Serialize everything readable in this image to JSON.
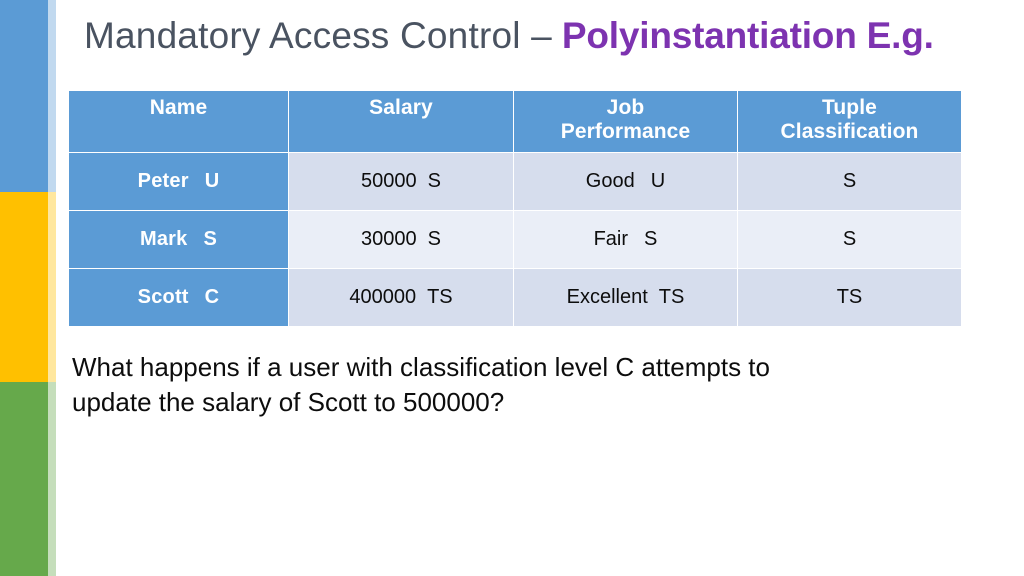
{
  "slide": {
    "title_main": "Mandatory Access Control –",
    "title_accent": "Polyinstantiation E.g.",
    "body_line1": "What happens if a user with classification level C attempts to",
    "body_line2": "update the salary of Scott to 500000?",
    "accent_color": "#7d33b0",
    "title_color": "#4a5361"
  },
  "sidebar": {
    "bands": [
      {
        "name": "blue-band",
        "color": "#5b9bd5"
      },
      {
        "name": "yellow-band",
        "color": "#ffc000"
      },
      {
        "name": "green-band",
        "color": "#66a94b"
      }
    ]
  },
  "table": {
    "header_color": "#5b9bd5",
    "row_color_a": "#d6dded",
    "row_color_b": "#eaeef7",
    "headers": [
      "Name",
      "Salary",
      "Job Performance",
      "Tuple Classification"
    ],
    "headers_wrapped": [
      [
        "Name",
        ""
      ],
      [
        "Salary",
        ""
      ],
      [
        "Job",
        "Performance"
      ],
      [
        "Tuple",
        "Classification"
      ]
    ],
    "rows": [
      {
        "name": "Peter",
        "name_class": "U",
        "salary": "50000",
        "salary_class": "S",
        "performance": "Good",
        "performance_class": "U",
        "tuple_classification": "S"
      },
      {
        "name": "Mark",
        "name_class": "S",
        "salary": "30000",
        "salary_class": "S",
        "performance": "Fair",
        "performance_class": "S",
        "tuple_classification": "S"
      },
      {
        "name": "Scott",
        "name_class": "C",
        "salary": "400000",
        "salary_class": "TS",
        "performance": "Excellent",
        "performance_class": "TS",
        "tuple_classification": "TS"
      }
    ]
  }
}
